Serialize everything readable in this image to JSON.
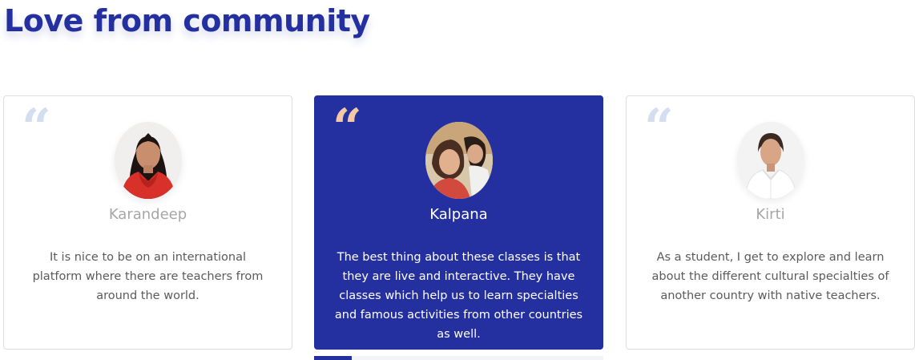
{
  "section": {
    "title": "Love from community"
  },
  "colors": {
    "accent": "#2430a0",
    "quote_light": "#d3dff0",
    "quote_warm": "#f4c8a4"
  },
  "testimonials": [
    {
      "name": "Karandeep",
      "text": "It is nice to be on an international platform where there are teachers from around the world.",
      "quote_icon": "quote-icon",
      "active": false
    },
    {
      "name": "Kalpana",
      "text": "The best thing about these classes is that they are live and interactive. They have classes which help us to learn specialties and famous activities from other countries as well.",
      "quote_icon": "quote-icon",
      "active": true
    },
    {
      "name": "Kirti",
      "text": "As a student, I get to explore and learn about the different cultural specialties of another country with native teachers.",
      "quote_icon": "quote-icon",
      "active": false
    }
  ],
  "carousel": {
    "progress": 0.13
  }
}
